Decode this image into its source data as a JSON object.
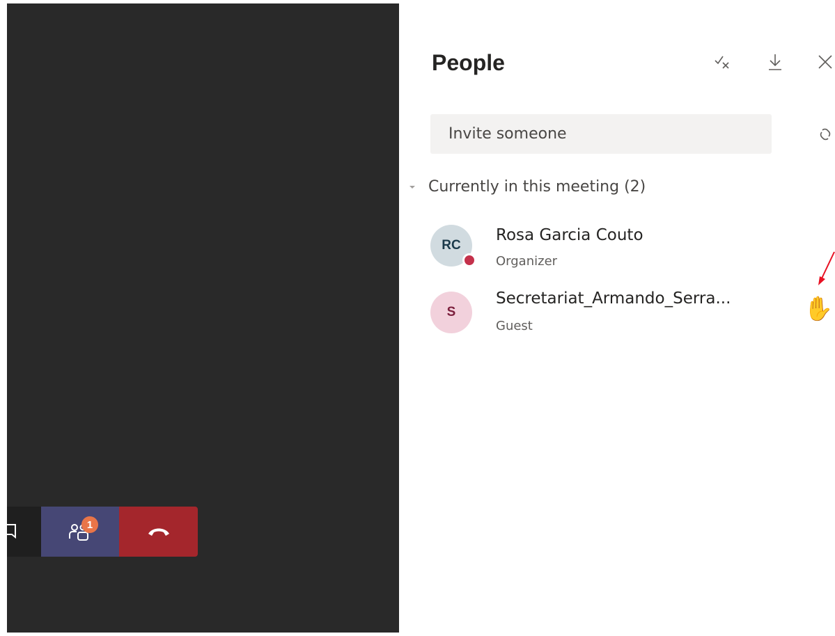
{
  "panel": {
    "title": "People",
    "invite_placeholder": "Invite someone",
    "section_label": "Currently in this meeting (2)",
    "participants": [
      {
        "initials": "RC",
        "name": "Rosa Garcia Couto",
        "role": "Organizer",
        "avatar_bg": "#d1dbe0",
        "avatar_fg": "#1b3a4b",
        "presence_color": "#c4314b"
      },
      {
        "initials": "S",
        "name": "Secretariat_Armando_Serra...",
        "role": "Guest",
        "avatar_bg": "#f2d1dc",
        "avatar_fg": "#7b1e3c",
        "hand_raised": "✋"
      }
    ],
    "icons": [
      "mute-all-icon",
      "download-icon",
      "close-icon",
      "share-link-icon",
      "chevron-down-icon",
      "raised-hand-icon"
    ]
  },
  "call_bar": {
    "people_badge": "1",
    "icons": [
      "chat-icon",
      "people-icon",
      "hang-up-icon"
    ],
    "colors": {
      "people_bg": "#464775",
      "hangup_bg": "#a4262c",
      "badge_bg": "#e97548"
    }
  },
  "annotation": {
    "arrow_color": "#e81123"
  }
}
